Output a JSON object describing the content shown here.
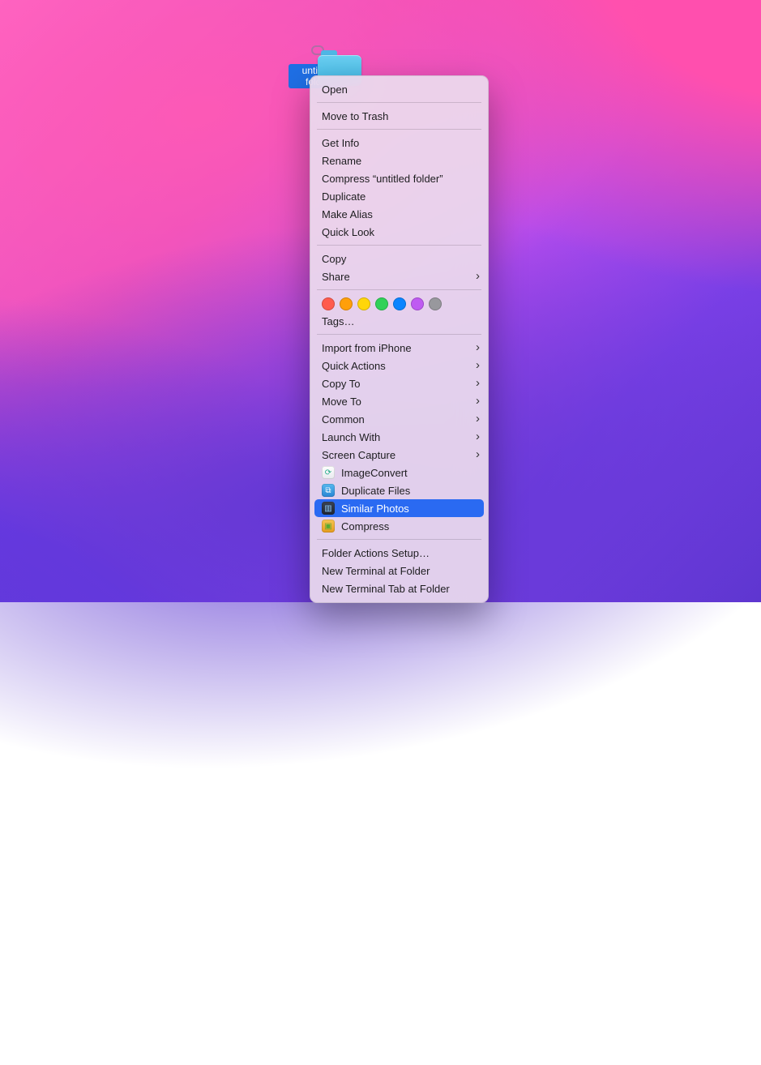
{
  "folder": {
    "name": "untitled folder"
  },
  "menu": {
    "open": "Open",
    "trash": "Move to Trash",
    "getinfo": "Get Info",
    "rename": "Rename",
    "compress": "Compress “untitled folder”",
    "duplicate": "Duplicate",
    "alias": "Make Alias",
    "quicklook": "Quick Look",
    "copy": "Copy",
    "share": "Share",
    "tags": "Tags…",
    "import": "Import from iPhone",
    "quickactions": "Quick Actions",
    "copyto": "Copy To",
    "moveto": "Move To",
    "common": "Common",
    "launchwith": "Launch With",
    "screencap": "Screen Capture",
    "imgconv": "ImageConvert",
    "dupfiles": "Duplicate Files",
    "simphotos": "Similar Photos",
    "compress2": "Compress",
    "fasetup": "Folder Actions Setup…",
    "newterm": "New Terminal at Folder",
    "newtab": "New Terminal Tab at Folder"
  },
  "tag_colors": [
    "#ff5b4e",
    "#ff9f0a",
    "#ffd60a",
    "#30d158",
    "#0a84ff",
    "#bf5af2",
    "#98989d"
  ]
}
